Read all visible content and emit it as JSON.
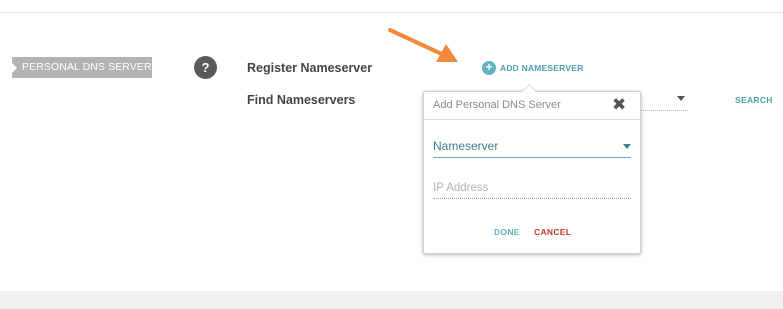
{
  "section": {
    "tag_label": "PERSONAL DNS SERVER"
  },
  "help": {
    "glyph": "?"
  },
  "rows": {
    "register_label": "Register Nameserver",
    "find_label": "Find Nameservers"
  },
  "add_nameserver": {
    "label": "ADD NAMESERVER",
    "icon_glyph": "+"
  },
  "search": {
    "label": "SEARCH"
  },
  "dialog": {
    "title": "Add Personal DNS Server",
    "close_glyph": "✖",
    "nameserver_select": {
      "value": "Nameserver"
    },
    "ip_field": {
      "placeholder": "IP Address",
      "value": ""
    },
    "done_label": "DONE",
    "cancel_label": "CANCEL"
  },
  "colors": {
    "accent": "#4aa3b0",
    "cancel": "#c0392b",
    "arrow": "#f08a3c",
    "tag": "#b3b3b3"
  },
  "icons": [
    "question-icon",
    "plus-circle-icon",
    "close-icon",
    "chevron-down-icon",
    "arrow-annotation-icon"
  ]
}
